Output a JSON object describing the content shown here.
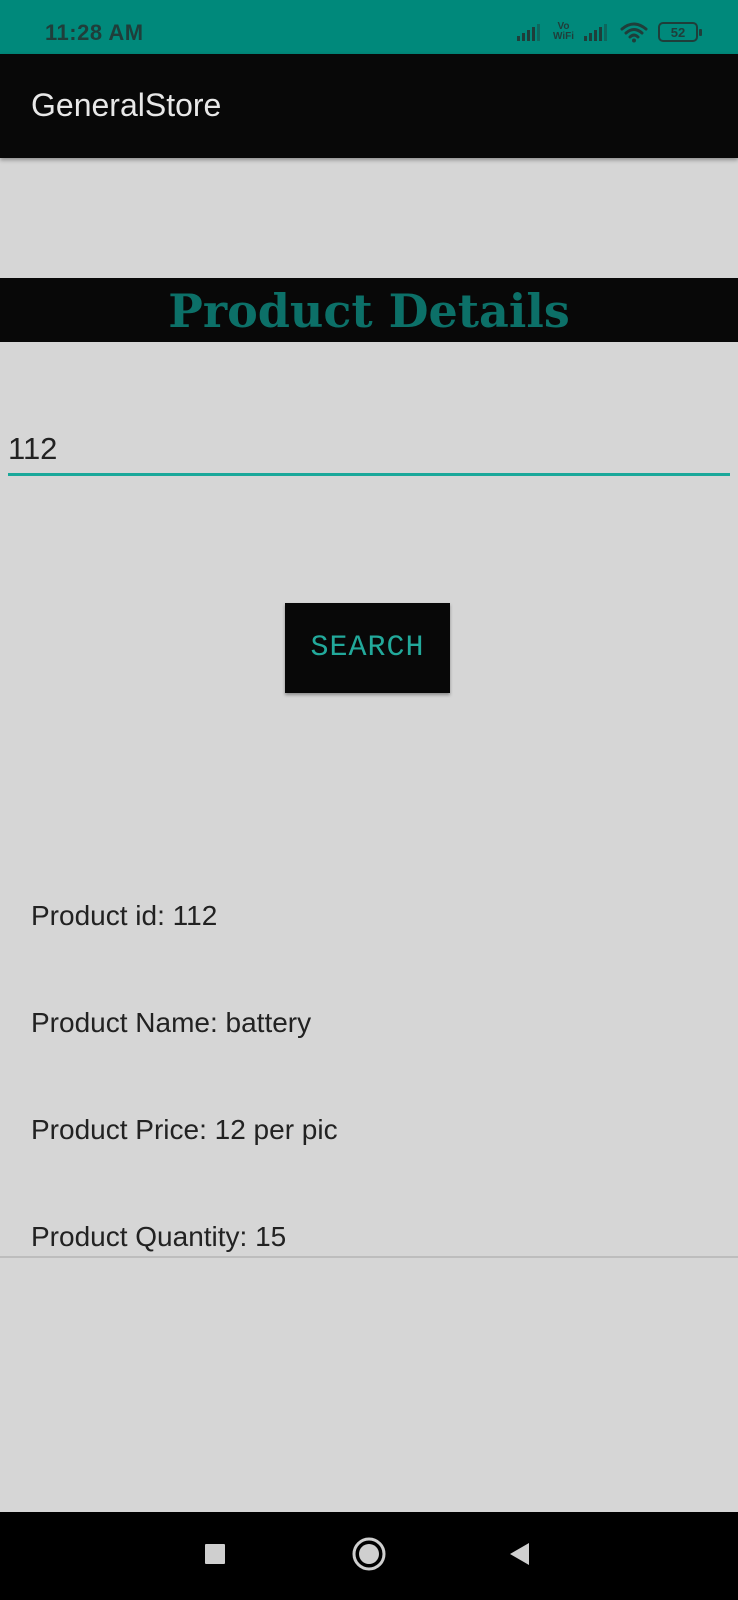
{
  "status_bar": {
    "time": "11:28 AM",
    "vowifi_top": "Vo",
    "vowifi_bottom": "WiFi",
    "battery": "52"
  },
  "app_bar": {
    "title": "GeneralStore"
  },
  "heading": {
    "text": "Product Details"
  },
  "search": {
    "value": "112",
    "button_label": "SEARCH"
  },
  "details": {
    "id": "Product id: 112",
    "name": "Product Name: battery",
    "price": "Product Price: 12 per pic",
    "quantity": "Product Quantity: 15"
  },
  "icons": {
    "signal": "signal-icon",
    "wifi": "wifi-icon",
    "battery": "battery-icon",
    "recents": "recents-icon",
    "home": "home-icon",
    "back": "back-icon"
  },
  "colors": {
    "status_bar": "#00897b",
    "app_bar": "#080808",
    "background": "#d6d6d6",
    "heading_text": "#0c7068",
    "accent": "#1aa89a"
  }
}
